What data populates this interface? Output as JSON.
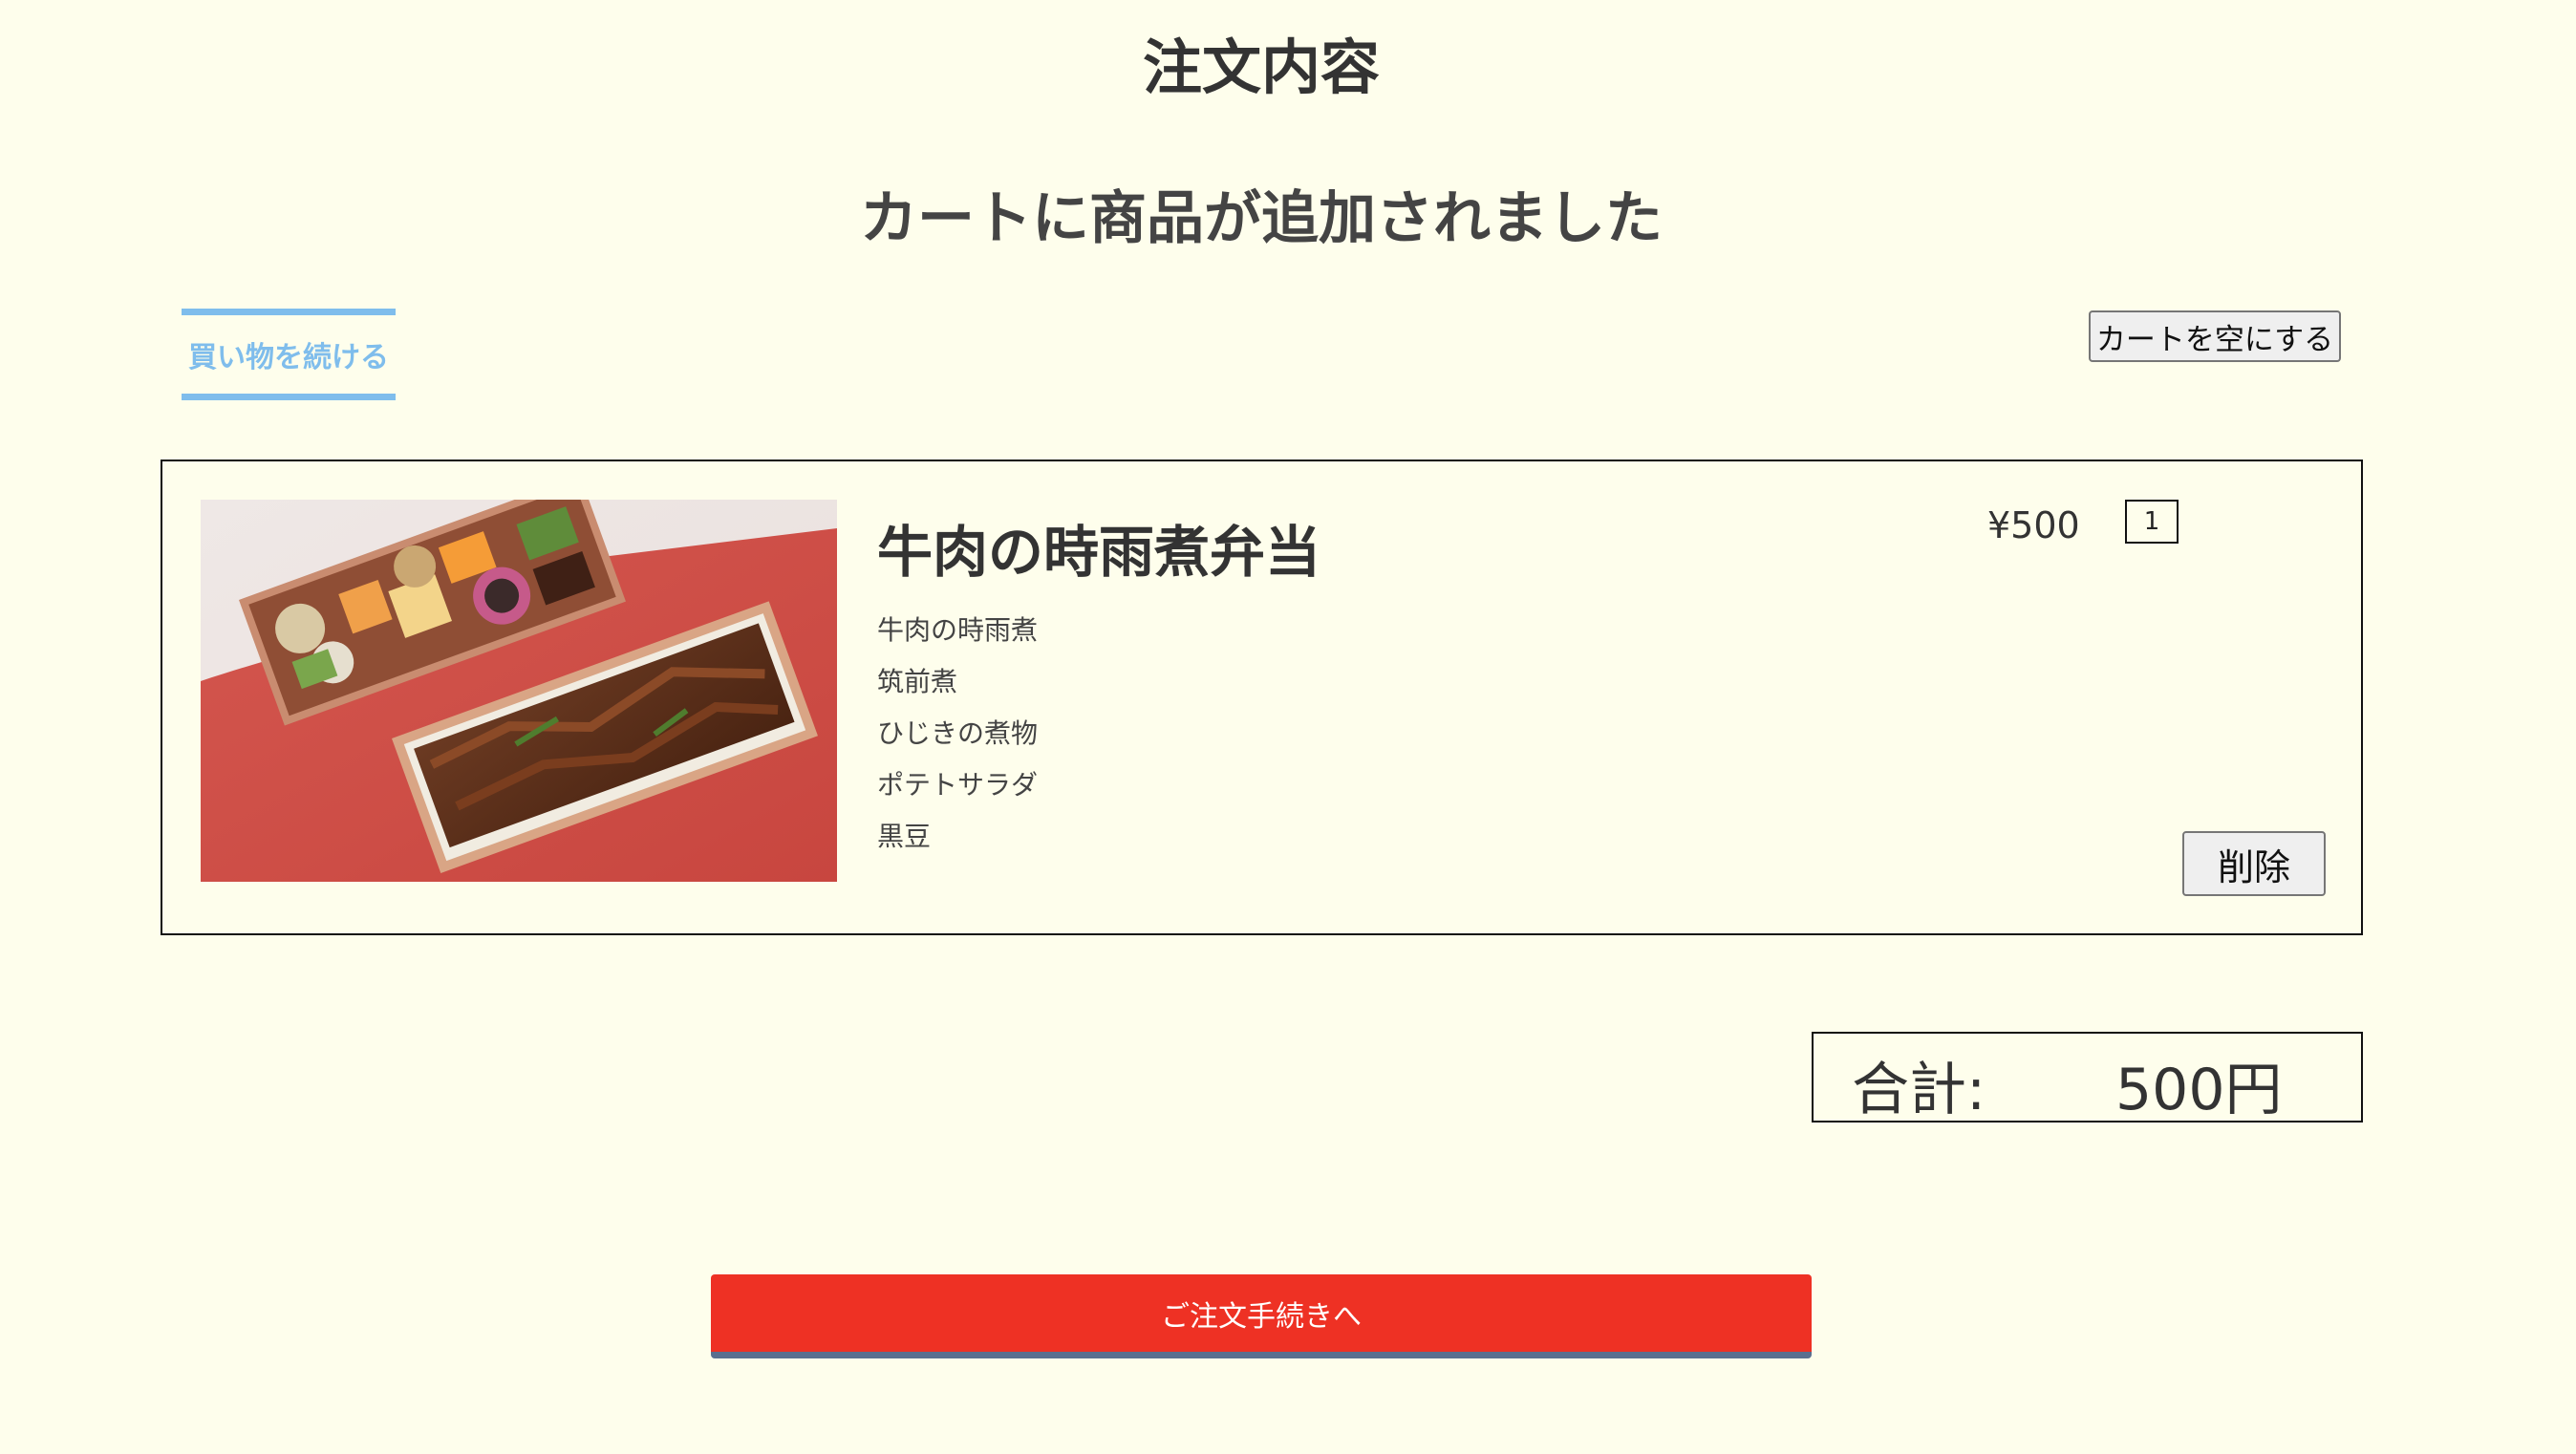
{
  "header": {
    "title": "注文内容",
    "subtitle": "カートに商品が追加されました"
  },
  "actions": {
    "continue_shopping": "買い物を続ける",
    "empty_cart": "カートを空にする"
  },
  "cart": {
    "items": [
      {
        "name": "牛肉の時雨煮弁当",
        "description": [
          "牛肉の時雨煮",
          "筑前煮",
          "ひじきの煮物",
          "ポテトサラダ",
          "黒豆"
        ],
        "price": "¥500",
        "quantity": "1",
        "delete_label": "削除",
        "image": "bento-photo"
      }
    ]
  },
  "summary": {
    "total_label": "合計:",
    "total_value": "500円"
  },
  "checkout": {
    "label": "ご注文手続きへ"
  },
  "colors": {
    "background": "#fefeec",
    "link_accent": "#7fbdec",
    "checkout_bg": "#ee3124",
    "checkout_shadow": "#5a6f8f"
  }
}
